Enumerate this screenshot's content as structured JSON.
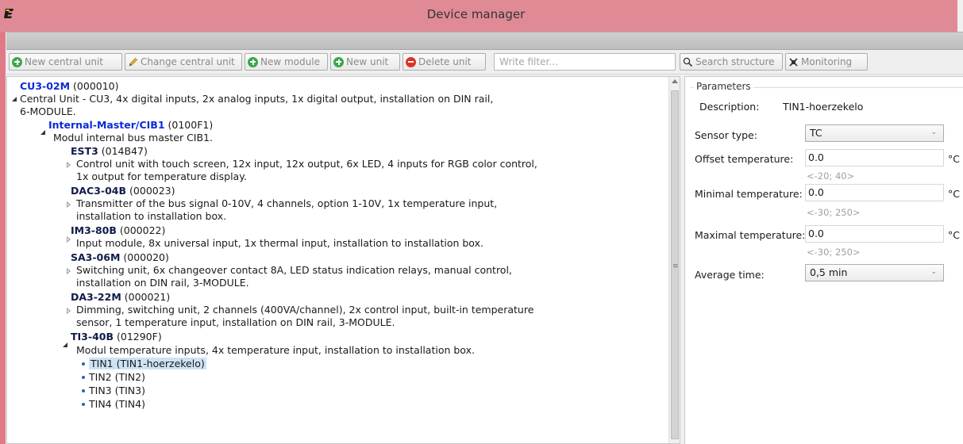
{
  "window": {
    "title": "Device manager"
  },
  "toolbar": {
    "new_central_unit": "New central unit",
    "change_central_unit": "Change central unit",
    "new_module": "New module",
    "new_unit": "New unit",
    "delete_unit": "Delete unit",
    "filter_placeholder": "Write filter...",
    "search_structure": "Search structure",
    "monitoring": "Monitoring"
  },
  "tree": {
    "cu": {
      "name": "CU3-02M",
      "code": "(000010)",
      "desc1": "Central Unit - CU3, 4x digital inputs, 2x analog inputs, 1x digital output, installation on DIN rail,",
      "desc2": "6-MODULE."
    },
    "cib": {
      "name": "Internal-Master/CIB1",
      "code": "(0100F1)",
      "desc": "Modul internal bus master CIB1."
    },
    "modules": [
      {
        "name": "EST3",
        "code": "(014B47)",
        "desc1": "Control unit with touch screen, 12x input, 12x output, 6x LED, 4 inputs for RGB color control,",
        "desc2": "1x output for temperature display."
      },
      {
        "name": "DAC3-04B",
        "code": "(000023)",
        "desc1": "Transmitter of the bus signal 0-10V, 4 channels, option 1-10V, 1x temperature input,",
        "desc2": "installation to installation box."
      },
      {
        "name": "IM3-80B",
        "code": "(000022)",
        "desc1": "Input module, 8x universal input, 1x thermal input, installation to installation box.",
        "desc2": ""
      },
      {
        "name": "SA3-06M",
        "code": "(000020)",
        "desc1": "Switching unit, 6x changeover contact 8A, LED status indication relays, manual control,",
        "desc2": "installation on DIN rail, 3-MODULE."
      },
      {
        "name": "DA3-22M",
        "code": "(000021)",
        "desc1": "Dimming, switching unit, 2 channels (400VA/channel), 2x control input, built-in temperature",
        "desc2": "sensor, 1 temperature input, installation on DIN rail, 3-MODULE."
      },
      {
        "name": "TI3-40B",
        "code": "(01290F)",
        "desc1": "Modul temperature inputs, 4x temperature input, installation to installation box.",
        "desc2": ""
      }
    ],
    "inputs": [
      "TIN1 (TIN1-hoerzekelo)",
      "TIN2 (TIN2)",
      "TIN3 (TIN3)",
      "TIN4 (TIN4)"
    ]
  },
  "parameters": {
    "group_title": "Parameters",
    "description_label": "Description:",
    "description_value": "TIN1-hoerzekelo",
    "sensor_type_label": "Sensor type:",
    "sensor_type_value": "TC",
    "offset_label": "Offset temperature:",
    "offset_value": "0.0",
    "offset_range": "<-20; 40>",
    "min_label": "Minimal temperature:",
    "min_value": "0.0",
    "min_range": "<-30; 250>",
    "max_label": "Maximal temperature:",
    "max_value": "0.0",
    "max_range": "<-30; 250>",
    "unit": "°C",
    "avg_label": "Average time:",
    "avg_value": "0,5 min"
  }
}
